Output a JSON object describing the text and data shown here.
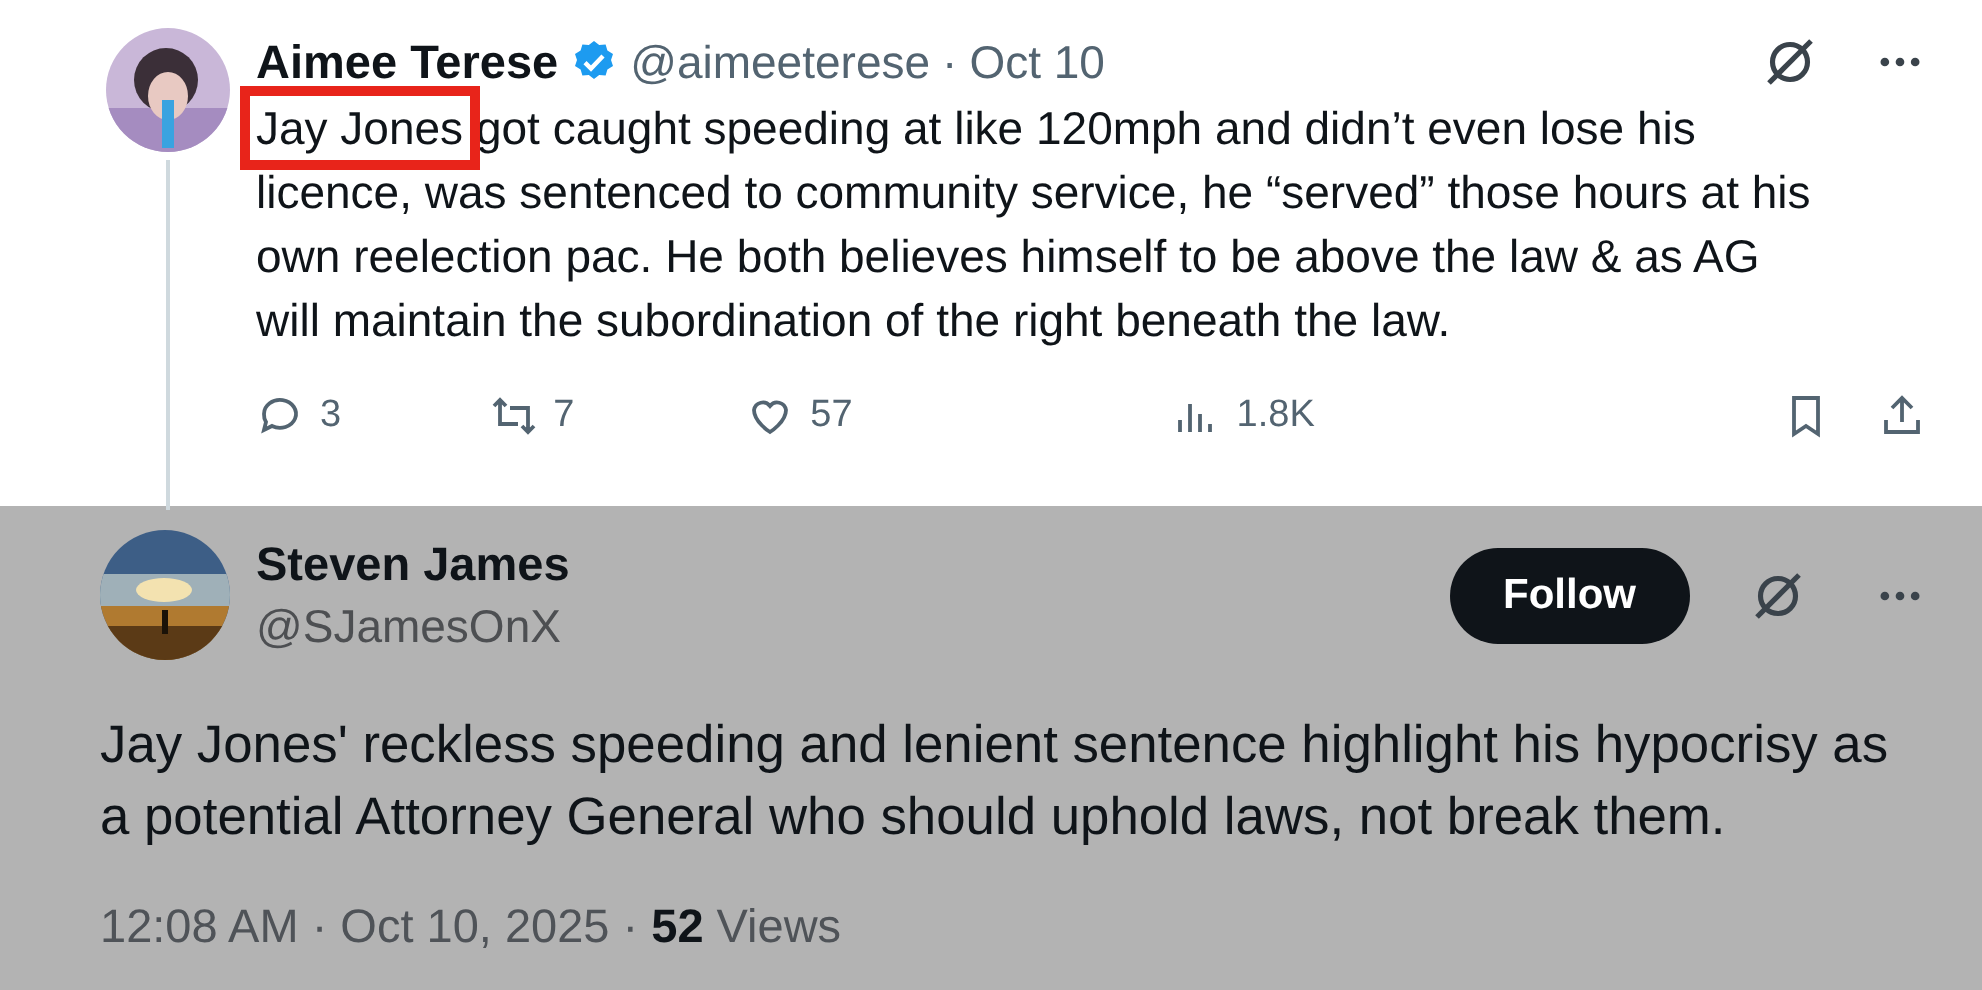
{
  "reply": {
    "name": "Aimee Terese",
    "verified": true,
    "handle": "@aimeeterese",
    "separator": "·",
    "date": "Oct 10",
    "highlighted_text": "Jay Jones",
    "text": "got caught speeding at like 120mph and didn’t even lose his licence, was sentenced to community service, he “served” those hours at his own reelection pac. He both believes himself to be above the law & as AG will maintain the subordination of the right beneath the law.",
    "actions": [
      {
        "kind": "reply",
        "count": "3"
      },
      {
        "kind": "repost",
        "count": "7"
      },
      {
        "kind": "like",
        "count": "57"
      },
      {
        "kind": "views",
        "count": "1.8K"
      }
    ]
  },
  "post": {
    "name": "Steven James",
    "handle": "@SJamesOnX",
    "follow_button": "Follow",
    "text": "Jay Jones' reckless speeding and lenient sentence highlight his hypocrisy as a potential Attorney General who should uphold laws, not break them.",
    "meta": "12:08 AM · Oct 10, 2025 · **52** Views"
  }
}
